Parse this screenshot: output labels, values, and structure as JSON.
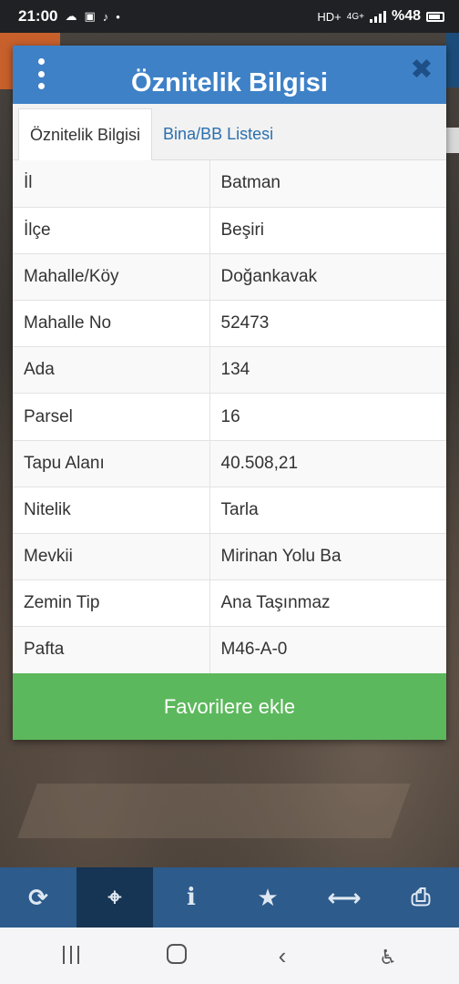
{
  "status_bar": {
    "time": "21:00",
    "battery_text": "%48",
    "network": "4G+",
    "hd_label": "HD+"
  },
  "dialog": {
    "title": "Öznitelik Bilgisi",
    "close_symbol": "✖",
    "tabs": [
      {
        "label": "Öznitelik Bilgisi",
        "active": true
      },
      {
        "label": "Bina/BB Listesi",
        "active": false
      }
    ],
    "rows": [
      {
        "key": "İl",
        "value": "Batman"
      },
      {
        "key": "İlçe",
        "value": "Beşiri"
      },
      {
        "key": "Mahalle/Köy",
        "value": "Doğankavak"
      },
      {
        "key": "Mahalle No",
        "value": "52473"
      },
      {
        "key": "Ada",
        "value": "134"
      },
      {
        "key": "Parsel",
        "value": "16"
      },
      {
        "key": "Tapu Alanı",
        "value": "40.508,21"
      },
      {
        "key": "Nitelik",
        "value": "Tarla"
      },
      {
        "key": "Mevkii",
        "value": "Mirinan Yolu Ba"
      },
      {
        "key": "Zemin Tip",
        "value": "Ana Taşınmaz"
      },
      {
        "key": "Pafta",
        "value": "M46-A-0"
      }
    ],
    "favorite_button": "Favorilere ekle"
  },
  "toolbar": {
    "items": [
      {
        "icon": "refresh-icon",
        "glyph": "⟳"
      },
      {
        "icon": "crosshair-icon",
        "glyph": "⌖",
        "active": true
      },
      {
        "icon": "info-icon",
        "glyph": "i"
      },
      {
        "icon": "star-icon",
        "glyph": "★"
      },
      {
        "icon": "horizontal-arrows-icon",
        "glyph": "⟷"
      },
      {
        "icon": "printer-icon",
        "glyph": "⎙"
      }
    ]
  },
  "colors": {
    "header_blue": "#3e81c7",
    "toolbar_blue": "#2c5b8c",
    "favorite_green": "#5cb85c",
    "tab_link": "#2a6fae"
  }
}
